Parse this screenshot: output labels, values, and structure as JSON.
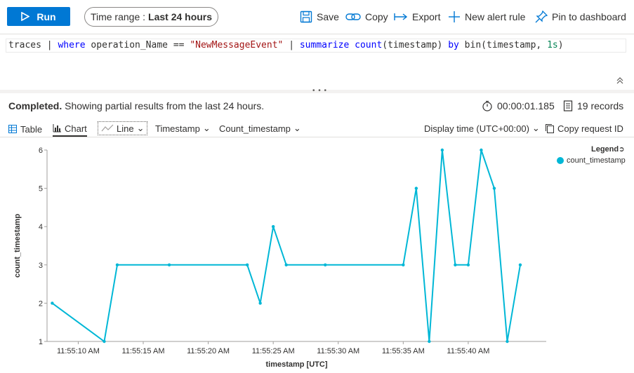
{
  "toolbar": {
    "run_label": "Run",
    "time_range_prefix": "Time range :",
    "time_range_value": "Last 24 hours",
    "save_label": "Save",
    "copy_label": "Copy",
    "export_label": "Export",
    "new_alert_label": "New alert rule",
    "pin_label": "Pin to dashboard"
  },
  "query": {
    "t1": "traces",
    "t2": " | ",
    "t3": "where",
    "t4": " operation_Name == ",
    "t5": "\"NewMessageEvent\"",
    "t6": " | ",
    "t7": "summarize",
    "t8": " ",
    "t9": "count",
    "t10": "(timestamp) ",
    "t11": "by",
    "t12": " bin(timestamp, ",
    "t13": "1s",
    "t14": ")"
  },
  "status": {
    "completed": "Completed.",
    "message": " Showing partial results from the last 24 hours.",
    "duration": "00:00:01.185",
    "records": "19 records"
  },
  "viewbar": {
    "table_label": "Table",
    "chart_label": "Chart",
    "chart_type": "Line",
    "x_column": "Timestamp",
    "y_column": "Count_timestamp",
    "display_time": "Display time (UTC+00:00)",
    "copy_request": "Copy request ID"
  },
  "legend": {
    "title": "Legend",
    "series_name": "count_timestamp"
  },
  "colors": {
    "accent": "#0078d4",
    "series": "#00b7d6"
  },
  "chart_data": {
    "type": "line",
    "xlabel": "timestamp [UTC]",
    "ylabel": "count_timestamp",
    "ylim": [
      1,
      6
    ],
    "y_ticks": [
      1,
      2,
      3,
      4,
      5,
      6
    ],
    "x_tick_labels": [
      "11:55:10 AM",
      "11:55:15 AM",
      "11:55:20 AM",
      "11:55:25 AM",
      "11:55:30 AM",
      "11:55:35 AM",
      "11:55:40 AM"
    ],
    "x_tick_seconds": [
      10,
      15,
      20,
      25,
      30,
      35,
      40
    ],
    "xlim_seconds": [
      7.6,
      46
    ],
    "legend_position": "top-right",
    "series": [
      {
        "name": "count_timestamp",
        "x_seconds": [
          8,
          12,
          13,
          17,
          23,
          24,
          25,
          26,
          29,
          35,
          36,
          37,
          38,
          39,
          40,
          41,
          42,
          43,
          44
        ],
        "values": [
          2,
          1,
          3,
          3,
          3,
          2,
          4,
          3,
          3,
          3,
          5,
          1,
          6,
          3,
          3,
          6,
          5,
          1,
          3
        ]
      }
    ]
  }
}
